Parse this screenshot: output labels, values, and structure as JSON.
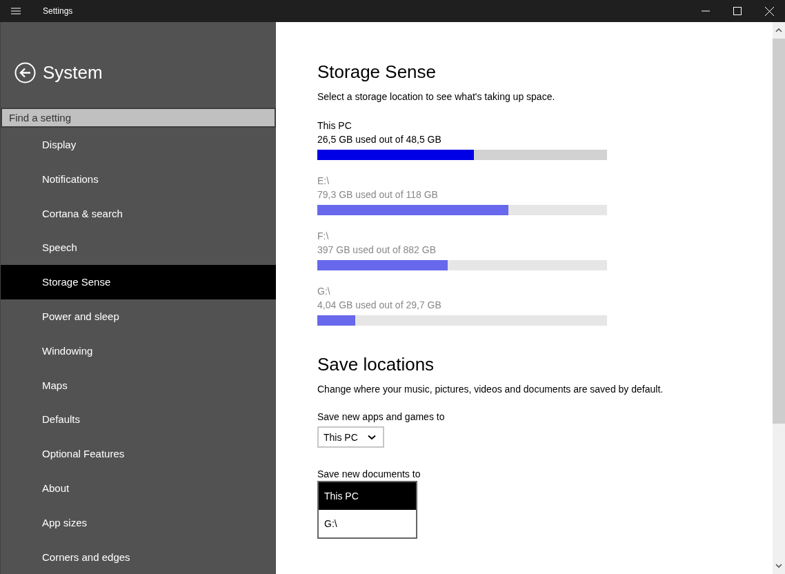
{
  "window": {
    "title": "Settings"
  },
  "sidebar": {
    "title": "System",
    "search": {
      "placeholder": "Find a setting"
    },
    "items": [
      {
        "label": "Display",
        "selected": false
      },
      {
        "label": "Notifications",
        "selected": false
      },
      {
        "label": "Cortana & search",
        "selected": false
      },
      {
        "label": "Speech",
        "selected": false
      },
      {
        "label": "Storage Sense",
        "selected": true
      },
      {
        "label": "Power and sleep",
        "selected": false
      },
      {
        "label": "Windowing",
        "selected": false
      },
      {
        "label": "Maps",
        "selected": false
      },
      {
        "label": "Defaults",
        "selected": false
      },
      {
        "label": "Optional Features",
        "selected": false
      },
      {
        "label": "About",
        "selected": false
      },
      {
        "label": "App sizes",
        "selected": false
      },
      {
        "label": "Corners and edges",
        "selected": false
      }
    ]
  },
  "storage_sense": {
    "title": "Storage Sense",
    "description": "Select a storage location to see what's taking up space.",
    "drives": [
      {
        "name": "This PC",
        "usage": "26,5 GB used out of 48,5 GB",
        "level": 0.54,
        "selected": true
      },
      {
        "name": "E:\\",
        "usage": "79,3 GB used out of 118 GB",
        "level": 0.66,
        "selected": false
      },
      {
        "name": "F:\\",
        "usage": "397 GB used out of 882 GB",
        "level": 0.45,
        "selected": false
      },
      {
        "name": "G:\\",
        "usage": "4,04 GB used out of 29,7 GB",
        "level": 0.13,
        "selected": false
      }
    ]
  },
  "save_locations": {
    "title": "Save locations",
    "description": "Change where your music, pictures, videos and documents are saved by default.",
    "settings": [
      {
        "label": "Save new apps and games to",
        "value": "This PC",
        "expanded": false
      },
      {
        "label": "Save new documents to",
        "expanded": true,
        "options": [
          {
            "label": "This PC",
            "selected": true
          },
          {
            "label": "G:\\",
            "selected": false
          }
        ]
      }
    ]
  }
}
